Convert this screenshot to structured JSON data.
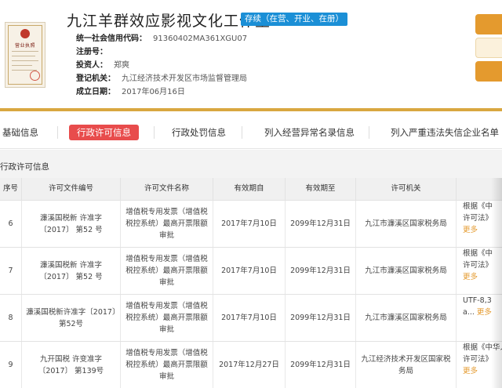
{
  "company": {
    "name": "九江羊群效应影视文化工作室",
    "status": "存续（在营、开业、在册）",
    "license_title": "营业执照"
  },
  "info": [
    {
      "key": "统一社会信用代码：",
      "value": "91360402MA361XGU07"
    },
    {
      "key": "注册号：",
      "value": ""
    },
    {
      "key": "投资人：",
      "value": "郑爽"
    },
    {
      "key": "登记机关：",
      "value": "九江经济技术开发区市场监督管理局"
    },
    {
      "key": "成立日期：",
      "value": "2017年06月16日"
    }
  ],
  "tabs": [
    {
      "label": "基础信息",
      "active": false
    },
    {
      "label": "行政许可信息",
      "active": true
    },
    {
      "label": "行政处罚信息",
      "active": false
    },
    {
      "label": "列入经营异常名录信息",
      "active": false
    },
    {
      "label": "列入严重违法失信企业名单（",
      "active": false
    }
  ],
  "section": {
    "title": "行政许可信息"
  },
  "table": {
    "headers": [
      "序号",
      "许可文件编号",
      "许可文件名称",
      "有效期自",
      "有效期至",
      "许可机关",
      ""
    ],
    "rows": [
      {
        "no": "6",
        "code": "濂溪国税新 许准字 〔2017〕 第52 号",
        "name": "增值税专用发票（增值税税控系统）最高开票限额审批",
        "from": "2017年7月10日",
        "to": "2099年12月31日",
        "authority": "九江市濂溪区国家税务局",
        "content": "根据《中",
        "content2": "许可法》",
        "more": "更多"
      },
      {
        "no": "7",
        "code": "濂溪国税新 许准字 〔2017〕 第52 号",
        "name": "增值税专用发票（增值税税控系统）最高开票限额审批",
        "from": "2017年7月10日",
        "to": "2099年12月31日",
        "authority": "九江市濂溪区国家税务局",
        "content": "根据《中",
        "content2": "许可法》",
        "more": "更多"
      },
      {
        "no": "8",
        "code": "濂溪国税新许准字〔2017〕第52号",
        "name": "增值税专用发票（增值税税控系统）最高开票限额审批",
        "from": "2017年7月10日",
        "to": "2099年12月31日",
        "authority": "九江市濂溪区国家税务局",
        "content": "UTF-8,3",
        "content2": "a...",
        "more": "更多"
      },
      {
        "no": "9",
        "code": "九开国税 许变准字 〔2017〕 第139号",
        "name": "增值税专用发票（增值税税控系统）最高开票限额审批",
        "from": "2017年12月27日",
        "to": "2099年12月31日",
        "authority": "九江经济技术开发区国家税务局",
        "content": "根据《中华人",
        "content2": "许可法》",
        "more": "更多"
      }
    ]
  },
  "colors": {
    "accent_red": "#e84c4c",
    "status_blue": "#1b8fd6",
    "gold": "#d9a740",
    "more_orange": "#e49a2e"
  }
}
